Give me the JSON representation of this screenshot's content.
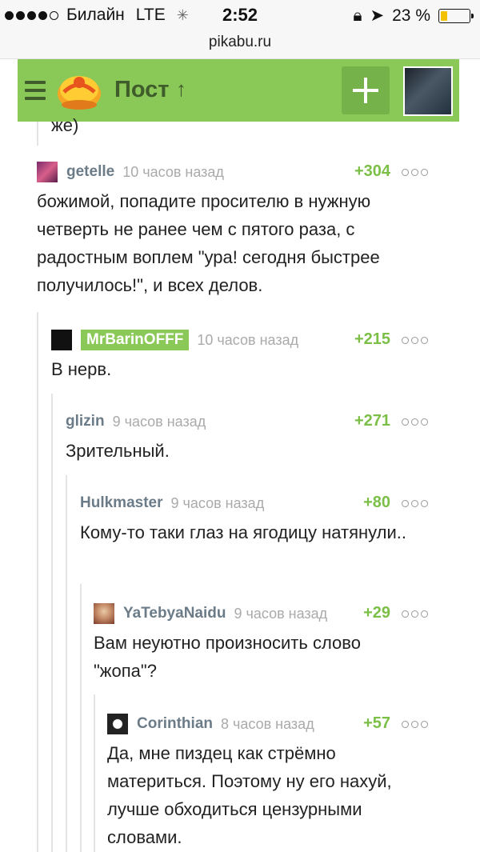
{
  "status_bar": {
    "carrier": "Билайн",
    "network": "LTE",
    "time": "2:52",
    "battery": "23 %",
    "battery_level": 0.23
  },
  "url": "pikabu.ru",
  "header": {
    "title": "Пост",
    "arrow": "↑",
    "brand_color": "#8ac858"
  },
  "cut_text": "же)",
  "comments": [
    {
      "author": "getelle",
      "time": "10 часов назад",
      "rating": "+304",
      "text": "божимой, попадите просителю в нужную четверть не ранее чем с пятого раза, с радостным воплем \"ура! сегодня быстрее получилось!\", и всех делов."
    },
    {
      "author": "MrBarinOFFF",
      "time": "10 часов назад",
      "rating": "+215",
      "text": "В нерв."
    },
    {
      "author": "glizin",
      "time": "9 часов назад",
      "rating": "+271",
      "text": "Зрительный."
    },
    {
      "author": "Hulkmaster",
      "time": "9 часов назад",
      "rating": "+80",
      "text": "Кому-то таки глаз на ягодицу натянули.."
    },
    {
      "author": "YaTebyaNaidu",
      "time": "9 часов назад",
      "rating": "+29",
      "text": "Вам неуютно произносить слово \"жопа\"?"
    },
    {
      "author": "Corinthian",
      "time": "8 часов назад",
      "rating": "+57",
      "text": "Да, мне пиздец как стрёмно материться. Поэтому ну его нахуй, лучше обходиться цензурными словами."
    }
  ]
}
